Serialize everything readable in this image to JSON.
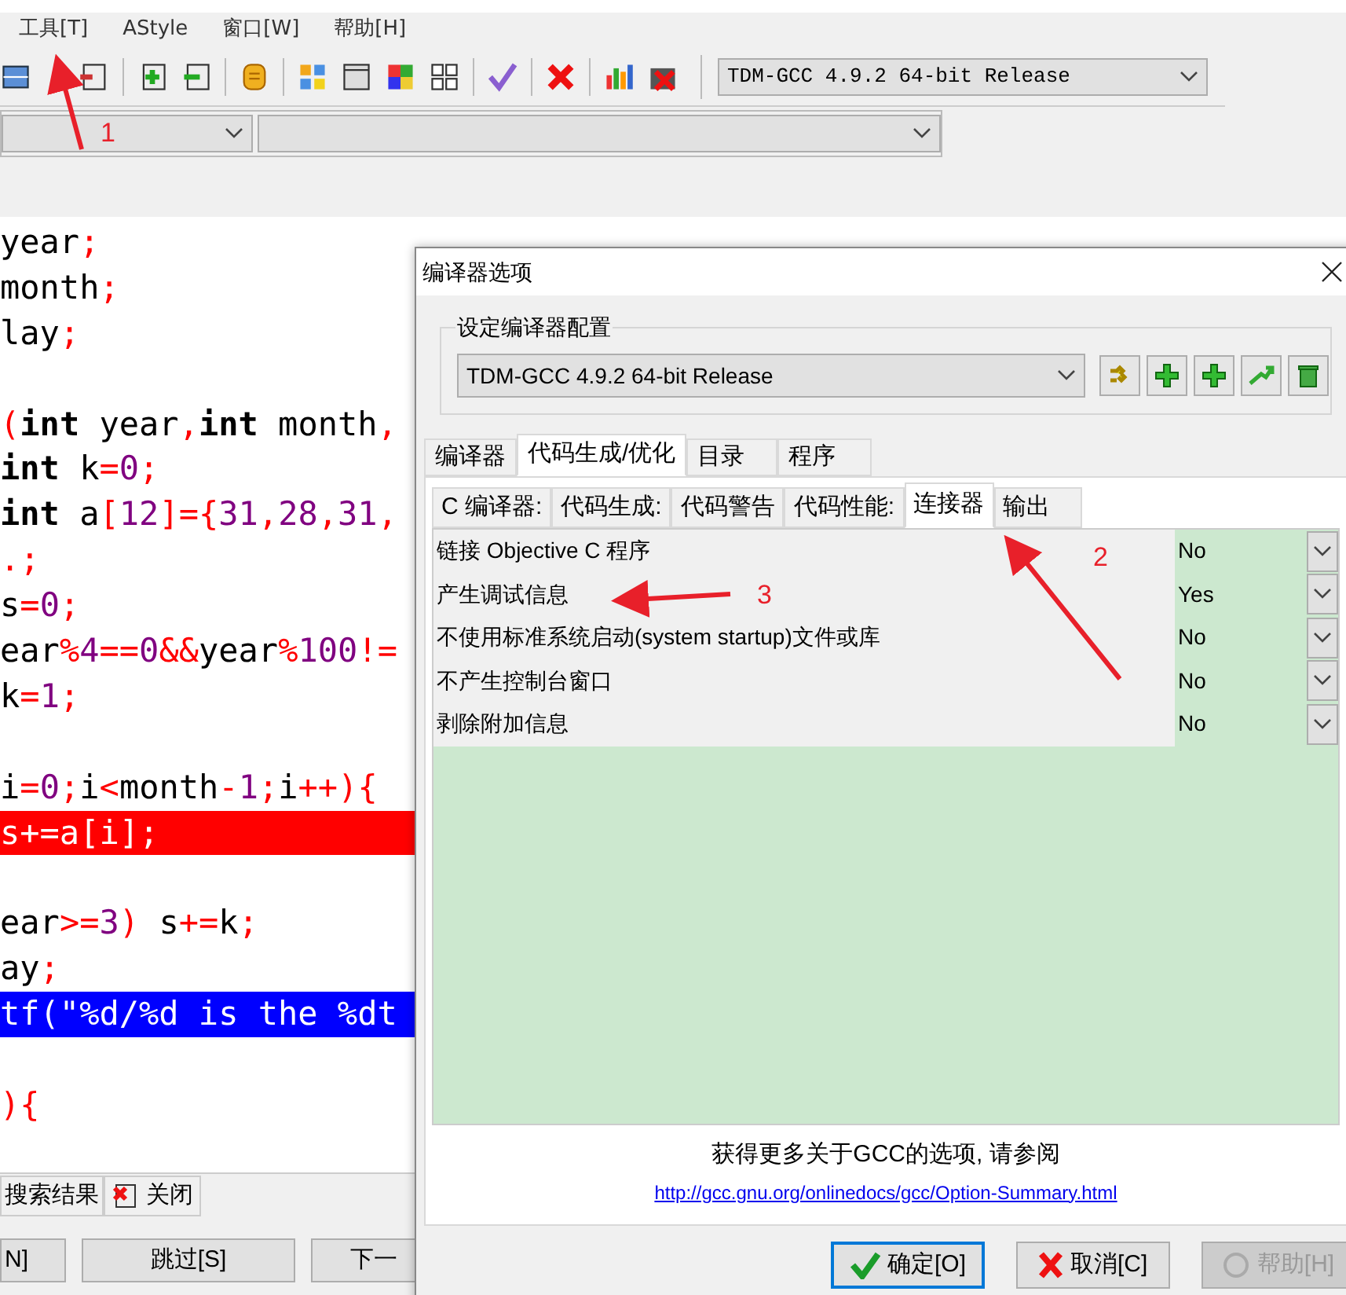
{
  "menu": [
    "工具[T]",
    "AStyle",
    "窗口[W]",
    "帮助[H]"
  ],
  "toolbar": {
    "compiler_select": "TDM-GCC 4.9.2 64-bit Release"
  },
  "editor": {
    "lines": [
      {
        "kind": "code",
        "tokens": [
          {
            "kind": "id",
            "text": "year"
          },
          {
            "kind": "p",
            "text": ";"
          }
        ]
      },
      {
        "kind": "code",
        "tokens": [
          {
            "kind": "id",
            "text": "month"
          },
          {
            "kind": "p",
            "text": ";"
          }
        ]
      },
      {
        "kind": "code",
        "tokens": [
          {
            "kind": "id",
            "text": "lay"
          },
          {
            "kind": "p",
            "text": ";"
          }
        ]
      },
      {
        "kind": "blank"
      },
      {
        "kind": "code",
        "tokens": [
          {
            "kind": "p",
            "text": "("
          },
          {
            "kind": "kw",
            "text": "int"
          },
          {
            "kind": "id",
            "text": " year"
          },
          {
            "kind": "p",
            "text": ","
          },
          {
            "kind": "kw",
            "text": "int"
          },
          {
            "kind": "id",
            "text": " month"
          },
          {
            "kind": "p",
            "text": ","
          }
        ]
      },
      {
        "kind": "code",
        "tokens": [
          {
            "kind": "kw",
            "text": "int"
          },
          {
            "kind": "id",
            "text": " k"
          },
          {
            "kind": "p",
            "text": "="
          },
          {
            "kind": "n",
            "text": "0"
          },
          {
            "kind": "p",
            "text": ";"
          }
        ]
      },
      {
        "kind": "code",
        "tokens": [
          {
            "kind": "kw",
            "text": "int"
          },
          {
            "kind": "id",
            "text": " a"
          },
          {
            "kind": "p",
            "text": "["
          },
          {
            "kind": "n",
            "text": "12"
          },
          {
            "kind": "p",
            "text": "]={"
          },
          {
            "kind": "n",
            "text": "31"
          },
          {
            "kind": "p",
            "text": ","
          },
          {
            "kind": "n",
            "text": "28"
          },
          {
            "kind": "p",
            "text": ","
          },
          {
            "kind": "n",
            "text": "31"
          },
          {
            "kind": "p",
            "text": ","
          }
        ]
      },
      {
        "kind": "code",
        "tokens": [
          {
            "kind": "p",
            "text": ".;"
          }
        ]
      },
      {
        "kind": "code",
        "tokens": [
          {
            "kind": "id",
            "text": "s"
          },
          {
            "kind": "p",
            "text": "="
          },
          {
            "kind": "n",
            "text": "0"
          },
          {
            "kind": "p",
            "text": ";"
          }
        ]
      },
      {
        "kind": "code",
        "tokens": [
          {
            "kind": "id",
            "text": "ear"
          },
          {
            "kind": "p",
            "text": "%"
          },
          {
            "kind": "n",
            "text": "4"
          },
          {
            "kind": "p",
            "text": "=="
          },
          {
            "kind": "n",
            "text": "0"
          },
          {
            "kind": "p",
            "text": "&&"
          },
          {
            "kind": "id",
            "text": "year"
          },
          {
            "kind": "p",
            "text": "%"
          },
          {
            "kind": "n",
            "text": "100"
          },
          {
            "kind": "p",
            "text": "!="
          }
        ]
      },
      {
        "kind": "code",
        "tokens": [
          {
            "kind": "id",
            "text": "k"
          },
          {
            "kind": "p",
            "text": "="
          },
          {
            "kind": "n",
            "text": "1"
          },
          {
            "kind": "p",
            "text": ";"
          }
        ]
      },
      {
        "kind": "blank"
      },
      {
        "kind": "code",
        "tokens": [
          {
            "kind": "id",
            "text": "i"
          },
          {
            "kind": "p",
            "text": "="
          },
          {
            "kind": "n",
            "text": "0"
          },
          {
            "kind": "p",
            "text": ";"
          },
          {
            "kind": "id",
            "text": "i"
          },
          {
            "kind": "p",
            "text": "<"
          },
          {
            "kind": "id",
            "text": "month"
          },
          {
            "kind": "p",
            "text": "-"
          },
          {
            "kind": "n",
            "text": "1"
          },
          {
            "kind": "p",
            "text": ";"
          },
          {
            "kind": "id",
            "text": "i"
          },
          {
            "kind": "p",
            "text": "++){"
          }
        ]
      },
      {
        "kind": "error",
        "text": "s+=a[i];"
      },
      {
        "kind": "blank"
      },
      {
        "kind": "code",
        "tokens": [
          {
            "kind": "id",
            "text": "ear"
          },
          {
            "kind": "p",
            "text": ">="
          },
          {
            "kind": "n",
            "text": "3"
          },
          {
            "kind": "p",
            "text": ")"
          },
          {
            "kind": "id",
            "text": " s"
          },
          {
            "kind": "p",
            "text": "+="
          },
          {
            "kind": "id",
            "text": "k"
          },
          {
            "kind": "p",
            "text": ";"
          }
        ]
      },
      {
        "kind": "code",
        "tokens": [
          {
            "kind": "id",
            "text": "ay"
          },
          {
            "kind": "p",
            "text": ";"
          }
        ]
      },
      {
        "kind": "selected",
        "text": "tf(\"%d/%d is the %dt"
      },
      {
        "kind": "blank"
      },
      {
        "kind": "code",
        "tokens": [
          {
            "kind": "p",
            "text": "){"
          }
        ]
      }
    ]
  },
  "bottom_tabs": [
    "搜索结果",
    "关闭"
  ],
  "bottom_buttons": [
    "N]",
    "跳过[S]",
    "下一"
  ],
  "dialog": {
    "title": "编译器选项",
    "group_label": "设定编译器配置",
    "profile_select": "TDM-GCC 4.9.2 64-bit Release",
    "tabs": [
      {
        "label": "编译器",
        "selected": false
      },
      {
        "label": "代码生成/优化",
        "selected": true
      },
      {
        "label": "目录",
        "selected": false
      },
      {
        "label": "程序",
        "selected": false
      }
    ],
    "subtabs": [
      {
        "label": "C 编译器:",
        "selected": false
      },
      {
        "label": "代码生成:",
        "selected": false
      },
      {
        "label": "代码警告",
        "selected": false
      },
      {
        "label": "代码性能:",
        "selected": false
      },
      {
        "label": "连接器",
        "selected": true
      },
      {
        "label": "输出",
        "selected": false
      }
    ],
    "options": [
      {
        "label": "链接 Objective C 程序",
        "value": "No"
      },
      {
        "label": "产生调试信息",
        "value": "Yes"
      },
      {
        "label": "不使用标准系统启动(system startup)文件或库",
        "value": "No"
      },
      {
        "label": "不产生控制台窗口",
        "value": "No"
      },
      {
        "label": "剥除附加信息",
        "value": "No"
      }
    ],
    "note": "获得更多关于GCC的选项, 请参阅",
    "link": "http://gcc.gnu.org/onlinedocs/gcc/Option-Summary.html",
    "buttons": [
      {
        "label": "确定[O]",
        "kind": "ok",
        "disabled": false
      },
      {
        "label": "取消[C]",
        "kind": "cancel",
        "disabled": false
      },
      {
        "label": "帮助[H]",
        "kind": "help",
        "disabled": true
      }
    ]
  },
  "annotations": [
    "1",
    "2",
    "3"
  ]
}
